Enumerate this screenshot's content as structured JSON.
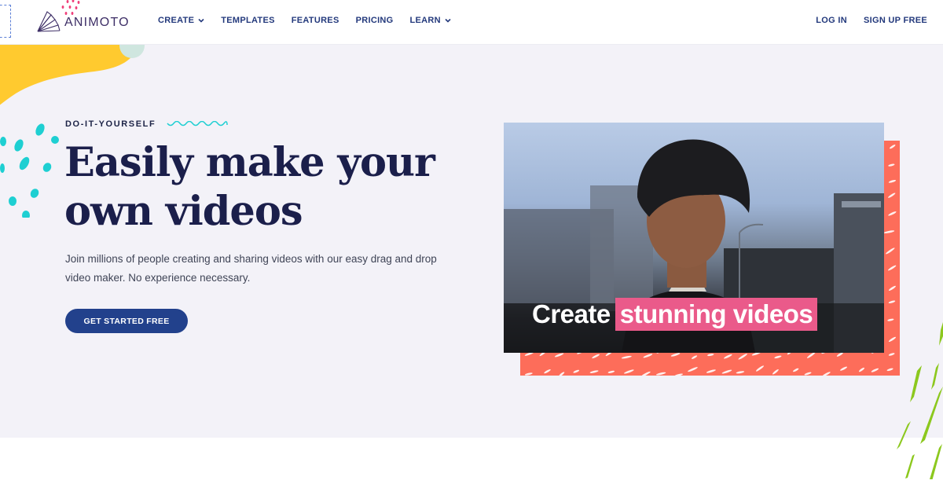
{
  "brand": {
    "name": "ANIMOTO",
    "logo_icon": "fan-logo-icon",
    "colors": {
      "navy": "#1b1f4b",
      "nav_blue": "#23397c",
      "button_blue": "#22418c",
      "yellow": "#ffca2f",
      "teal": "#1ecfd2",
      "coral": "#fd6d5a",
      "pink": "#ea5a8a",
      "green": "#8cc81e",
      "hero_bg": "#f3f2f8"
    }
  },
  "nav": {
    "items": [
      {
        "label": "CREATE",
        "has_dropdown": true
      },
      {
        "label": "TEMPLATES",
        "has_dropdown": false
      },
      {
        "label": "FEATURES",
        "has_dropdown": false
      },
      {
        "label": "PRICING",
        "has_dropdown": false
      },
      {
        "label": "LEARN",
        "has_dropdown": true
      }
    ],
    "login_label": "LOG IN",
    "signup_label": "SIGN UP FREE"
  },
  "hero": {
    "eyebrow": "DO-IT-YOURSELF",
    "headline_line1": "Easily make your",
    "headline_line2": "own videos",
    "subtext": "Join millions of people creating and sharing videos with our easy drag and drop video maker. No experience necessary.",
    "cta_label": "GET STARTED FREE"
  },
  "video": {
    "caption_plain": "Create",
    "caption_highlight": "stunning videos"
  }
}
